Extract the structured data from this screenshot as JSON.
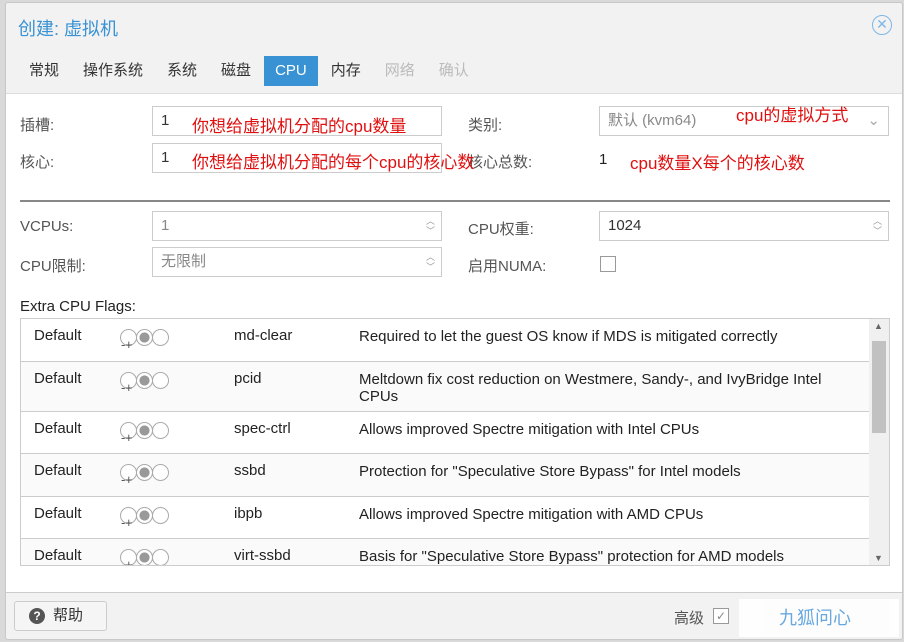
{
  "title": "创建: 虚拟机",
  "tabs": [
    {
      "label": "常规"
    },
    {
      "label": "操作系统"
    },
    {
      "label": "系统"
    },
    {
      "label": "磁盘"
    },
    {
      "label": "CPU"
    },
    {
      "label": "内存"
    },
    {
      "label": "网络"
    },
    {
      "label": "确认"
    }
  ],
  "form": {
    "sockets_label": "插槽:",
    "sockets_value": "1",
    "cores_label": "核心:",
    "cores_value": "1",
    "type_label": "类别:",
    "type_value": "默认 (kvm64)",
    "total_label": "核心总数:",
    "total_value": "1",
    "vcpus_label": "VCPUs:",
    "vcpus_value": "1",
    "weight_label": "CPU权重:",
    "weight_value": "1024",
    "limit_label": "CPU限制:",
    "limit_value": "无限制",
    "numa_label": "启用NUMA:",
    "flags_label": "Extra CPU Flags:"
  },
  "annotations": {
    "sockets": "你想给虚拟机分配的cpu数量",
    "cores": "你想给虚拟机分配的每个cpu的核心数",
    "type": "cpu的虚拟方式",
    "total": "cpu数量X每个的核心数"
  },
  "flags": [
    {
      "state": "Default",
      "name": "md-clear",
      "desc": "Required to let the guest OS know if MDS is mitigated correctly"
    },
    {
      "state": "Default",
      "name": "pcid",
      "desc": "Meltdown fix cost reduction on Westmere, Sandy-, and IvyBridge Intel CPUs"
    },
    {
      "state": "Default",
      "name": "spec-ctrl",
      "desc": "Allows improved Spectre mitigation with Intel CPUs"
    },
    {
      "state": "Default",
      "name": "ssbd",
      "desc": "Protection for \"Speculative Store Bypass\" for Intel models"
    },
    {
      "state": "Default",
      "name": "ibpb",
      "desc": "Allows improved Spectre mitigation with AMD CPUs"
    },
    {
      "state": "Default",
      "name": "virt-ssbd",
      "desc": "Basis for \"Speculative Store Bypass\" protection for AMD models"
    }
  ],
  "footer": {
    "help": "帮助",
    "advanced": "高级",
    "advanced_checked": true
  },
  "watermark": "九狐问心 JiuHuCN",
  "colors": {
    "accent": "#3892d4",
    "annotation": "#e01010"
  }
}
